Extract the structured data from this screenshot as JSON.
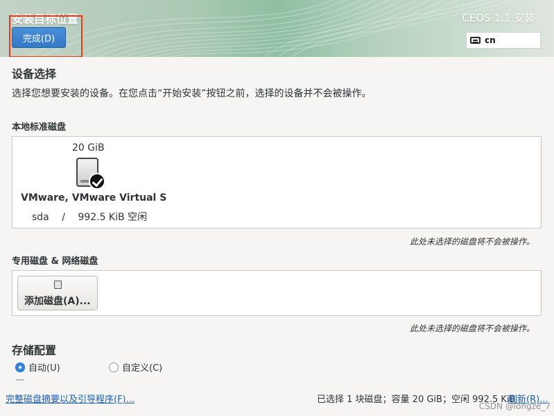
{
  "header": {
    "title": "安装目标位置",
    "product": "CEOS 1.1 安装",
    "done_label": "完成(D)",
    "keyboard_layout": "cn"
  },
  "device_selection": {
    "heading": "设备选择",
    "description": "选择您想要安装的设备。在您点击“开始安装”按钮之前，选择的设备并不会被操作。"
  },
  "local_disks": {
    "heading": "本地标准磁盘",
    "disks": [
      {
        "size": "20 GiB",
        "model": "VMware, VMware Virtual S",
        "name": "sda",
        "separator": "/",
        "free": "992.5 KiB 空闲",
        "selected": true
      }
    ],
    "note": "此处未选择的磁盘将不会被操作。"
  },
  "special_disks": {
    "heading": "专用磁盘 & 网络磁盘",
    "add_label": "添加磁盘(A)...",
    "note": "此处未选择的磁盘将不会被操作。"
  },
  "storage_config": {
    "heading": "存储配置",
    "options": [
      {
        "label": "自动(U)",
        "selected": true
      },
      {
        "label": "自定义(C)",
        "selected": false
      }
    ]
  },
  "footer": {
    "summary_link": "完整磁盘摘要以及引导程序(F)...",
    "status": "已选择 1 块磁盘；容量 20 GiB；空闲 992.5 KiB",
    "refresh_link": "刷新(R)..."
  },
  "watermark": "CSDN @longze_7",
  "colors": {
    "accent": "#3584e4",
    "highlight_box": "#e63a1b",
    "link": "#1a5fb4"
  }
}
